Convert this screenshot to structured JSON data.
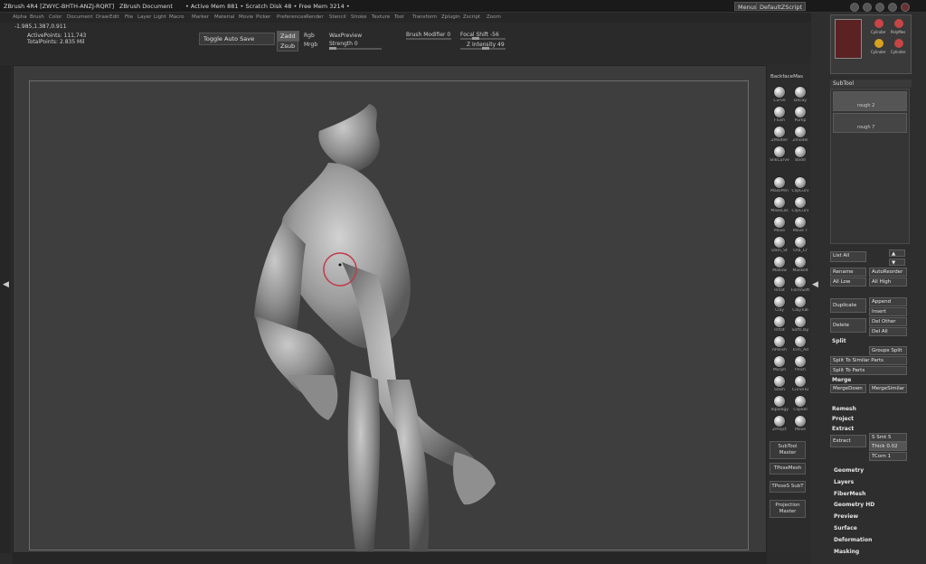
{
  "titlebar": {
    "app": "ZBrush 4R4 [ZWYC-BHTH-ANZJ-RQRT]",
    "document": "ZBrush Document",
    "active_mem": "• Active Mem 881 • Scratch Disk 48 • Free Mem 3214 •",
    "menus_btn": "Menus",
    "script": "DefaultZScript"
  },
  "menubar": [
    "Alpha",
    "Brush",
    "Color",
    "Document",
    "Draw",
    "Edit",
    "File",
    "Layer",
    "Light",
    "Macro",
    "Marker",
    "Material",
    "Movie",
    "Picker",
    "Preferences",
    "Render",
    "Stencil",
    "Stroke",
    "Texture",
    "Tool",
    "Transform",
    "Zplugin",
    "Zscript",
    "Zoom"
  ],
  "toolbar": {
    "coords": "-1.985,1.387,0.911",
    "active_points": "ActivePoints: 111,743",
    "total_points": "TotalPoints: 2.835 Mil",
    "toggle_auto_save": "Toggle Auto Save",
    "zadd": "Zadd",
    "zsub": "Zsub",
    "rgb": "Rgb",
    "mrgb": "Mrgb",
    "wax_preview": "WaxPreview",
    "strength": "Strength 0",
    "brush_modifier": "Brush Modifier 0",
    "focal_shift": "Focal Shift -56",
    "z_intensity": "Z Intensity 49"
  },
  "brushes": {
    "header": "BackfaceMas",
    "items": [
      "Curve",
      "Decay",
      "Flush",
      "Pump",
      "ZModelr",
      "Zmodel",
      "SnkCurve",
      "Badd",
      "MaskPen",
      "ClipCurv",
      "MaskLas",
      "ClipCurv",
      "Move",
      "Move T",
      "Dam_St",
      "Orb_Cr",
      "Mallow",
      "Masked",
      "Inflat",
      "FormSoft",
      "Clay",
      "ClayTub",
      "Inflat",
      "SoftClay",
      "hPolish",
      "Trim_Ad",
      "Morph",
      "Pinch",
      "Slash",
      "CurveTu",
      "Topology",
      "ClipSel",
      "ZProjct",
      "Move"
    ],
    "subtool_master": "SubTool Master",
    "tpose_mesh": "TPoseMesh",
    "tposes_subt": "TPoseS SubT",
    "projection_master": "Projection Master"
  },
  "right": {
    "subtool_header": "SubTool",
    "subtools": [
      "rough 2",
      "rough 7"
    ],
    "tool_icons": [
      "Cylinder",
      "PolyMes",
      "Cylinder",
      "Cylinder"
    ],
    "list_all": "List All",
    "rename": "Rename",
    "autoreorder": "AutoReorder",
    "all_low": "All Low",
    "all_high": "All High",
    "duplicate": "Duplicate",
    "append": "Append",
    "insert": "Insert",
    "delete": "Delete",
    "del_other": "Del Other",
    "del_all": "Del All",
    "split": "Split",
    "groups_split": "Groups Split",
    "split_similar": "Split To Similar Parts",
    "split_parts": "Split To Parts",
    "merge": "Merge",
    "merge_down": "MergeDown",
    "merge_similar": "MergeSimilar",
    "remesh": "Remesh",
    "project": "Project",
    "extract": "Extract",
    "extract_btn": "Extract",
    "s_smt": "S Smt 5",
    "thick": "Thick 0.02",
    "tcorn": "TCorn 1",
    "sections": [
      "Geometry",
      "Layers",
      "FiberMesh",
      "Geometry HD",
      "Preview",
      "Surface",
      "Deformation",
      "Masking"
    ]
  }
}
